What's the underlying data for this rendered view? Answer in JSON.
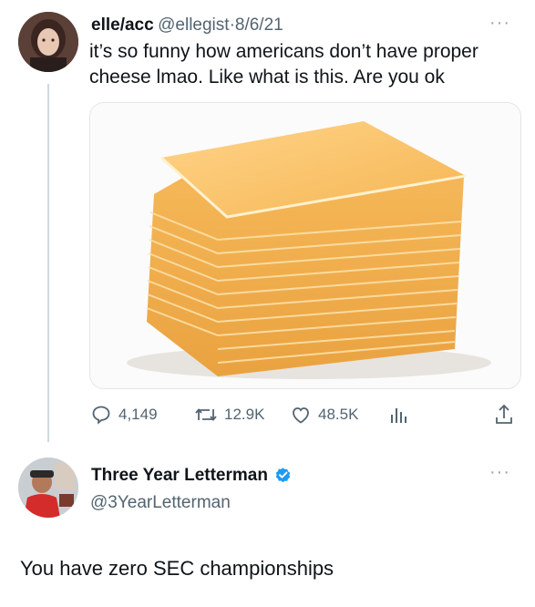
{
  "tweet": {
    "display_name": "elle/acc",
    "handle": "@ellegist",
    "separator": "·",
    "date": "8/6/21",
    "text_line1": "it’s so funny how americans don’t have proper",
    "text_line2": "cheese lmao. Like what is this. Are you ok",
    "more_label": "···",
    "stats": {
      "replies": "4,149",
      "retweets": "12.9K",
      "likes": "48.5K"
    },
    "icons": [
      "reply-icon",
      "retweet-icon",
      "like-icon",
      "views-icon",
      "share-icon"
    ],
    "media_alt": "stack of american cheese slices"
  },
  "reply": {
    "display_name": "Three Year Letterman",
    "handle": "@3YearLetterman",
    "more_label": "···",
    "text": "You have zero SEC championships",
    "verified_color": "#1d9bf0"
  },
  "colors": {
    "text": "#0f1419",
    "secondary": "#536471",
    "cheese": "#f7c063",
    "cheese_edge": "#e9a23f"
  }
}
